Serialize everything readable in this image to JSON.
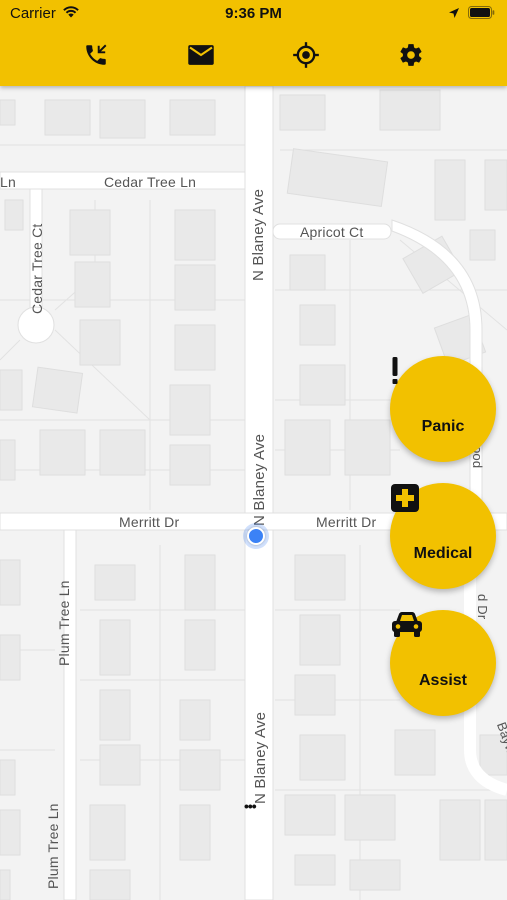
{
  "status_bar": {
    "carrier": "Carrier",
    "time": "9:36 PM"
  },
  "toolbar": {
    "icons": [
      "phone-icon",
      "mail-icon",
      "locate-icon",
      "gear-icon"
    ]
  },
  "map": {
    "streets": {
      "cedar_tree_ln_left": "Ln",
      "cedar_tree_ln": "Cedar Tree Ln",
      "cedar_tree_ct": "Cedar Tree Ct",
      "apricot_ct": "Apricot Ct",
      "n_blaney_ave_top": "N Blaney Ave",
      "n_blaney_ave_mid": "N Blaney Ave",
      "n_blaney_ave_bottom": "N Blaney Ave",
      "merritt_dr_left": "Merritt Dr",
      "merritt_dr_right": "Merritt Dr",
      "plum_tree_ln_top": "Plum Tree Ln",
      "plum_tree_ln_bottom": "Plum Tree Ln",
      "right_edge_1": "ood",
      "right_edge_2": "d Dr",
      "right_edge_3": "Baywoo"
    }
  },
  "actions": {
    "panic": "Panic",
    "medical": "Medical",
    "assist": "Assist"
  },
  "colors": {
    "accent": "#f2c100",
    "location": "#3b82f6"
  }
}
